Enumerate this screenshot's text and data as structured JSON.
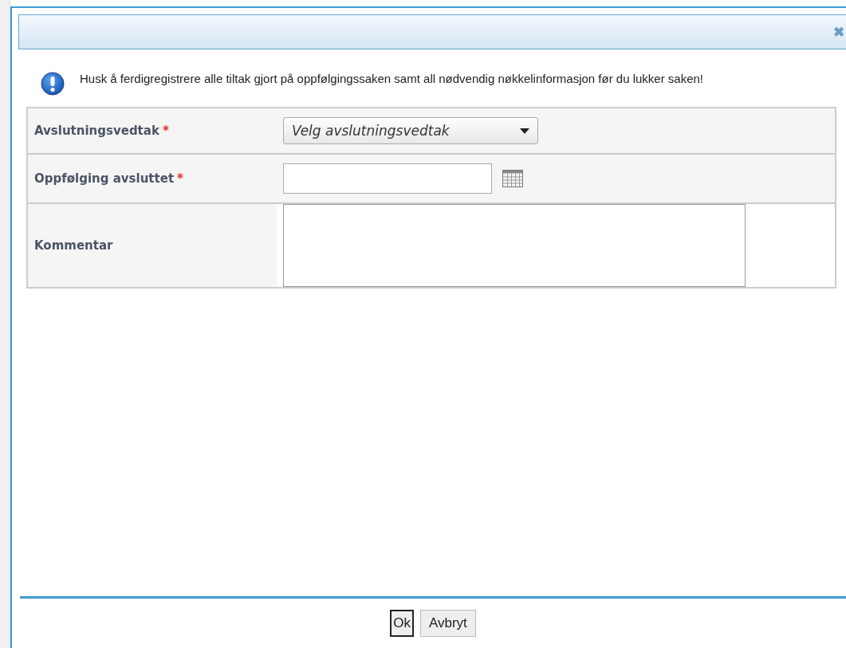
{
  "dialog": {
    "close_icon": "✖",
    "message": "Husk å ferdigregistrere alle tiltak gjort på oppfølgingssaken samt all nødvendig nøkkelinformasjon før du lukker saken!",
    "fields": [
      {
        "kind": "select",
        "label": "Avslutningsvedtak",
        "marker": "*",
        "value": "Velg avslutningsvedtak"
      },
      {
        "kind": "date",
        "label": "Oppfølging avsluttet",
        "marker": "*"
      },
      {
        "kind": "textarea",
        "label": "Kommentar"
      }
    ],
    "buttons": [
      {
        "label": "Ok",
        "selected": true
      },
      {
        "label": "Avbryt",
        "selected": false
      }
    ]
  }
}
